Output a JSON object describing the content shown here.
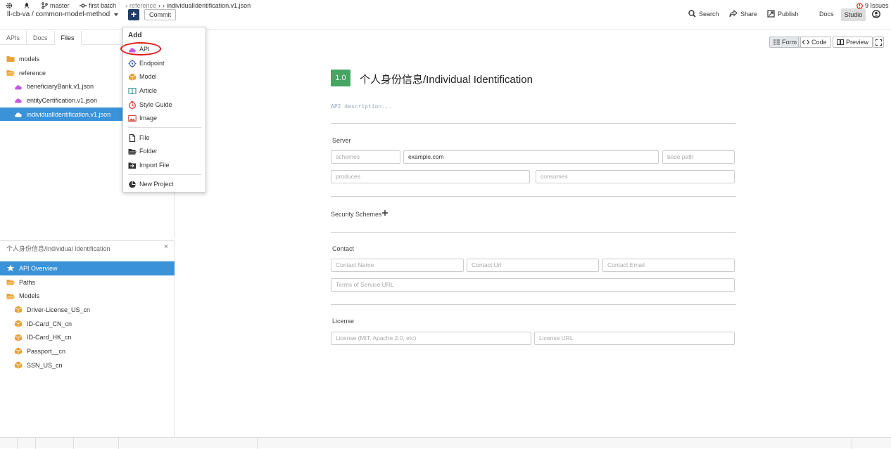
{
  "topbar": {
    "project": "ll-cb-va / common-model-method",
    "add_label": "+",
    "commit_label": "Commit",
    "search_label": "Search",
    "share_label": "Share",
    "publish_label": "Publish",
    "docs_label": "Docs",
    "studio_label": "Studio"
  },
  "sidebar": {
    "tabs": [
      "APIs",
      "Docs",
      "Files"
    ],
    "active_tab": "Files",
    "files": [
      {
        "label": "models",
        "type": "folder"
      },
      {
        "label": "reference",
        "type": "folder"
      },
      {
        "label": "beneficiaryBank.v1.json",
        "type": "api"
      },
      {
        "label": "entityCertification.v1.json",
        "type": "api"
      },
      {
        "label": "individualIdentification.v1.json",
        "type": "api",
        "selected": true
      }
    ]
  },
  "outline": {
    "title": "个人身份信息/Individual Identification",
    "close": "×",
    "items": [
      {
        "label": "API Overview",
        "type": "star",
        "selected": true
      },
      {
        "label": "Paths",
        "type": "folder"
      },
      {
        "label": "Models",
        "type": "folder"
      },
      {
        "label": "Driver-License_US_cn",
        "type": "model"
      },
      {
        "label": "ID-Card_CN_cn",
        "type": "model"
      },
      {
        "label": "ID-Card_HK_cn",
        "type": "model"
      },
      {
        "label": "Passport__cn",
        "type": "model"
      },
      {
        "label": "SSN_US_cn",
        "type": "model"
      }
    ]
  },
  "dropdown": {
    "header": "Add",
    "items": [
      "API",
      "Endpoint",
      "Model",
      "Article",
      "Style Guide",
      "Image"
    ],
    "items2": [
      "File",
      "Folder",
      "Import File"
    ],
    "items3": [
      "New Project"
    ]
  },
  "toolbar": {
    "form_label": "Form",
    "code_label": "Code",
    "preview_label": "Preview"
  },
  "editor": {
    "version": "1.0",
    "title": "个人身份信息/Individual Identification",
    "description_placeholder": "API description...",
    "server_label": "Server",
    "schemes_placeholder": "schemes",
    "host_value": "example.com",
    "basepath_placeholder": "base path",
    "produces_placeholder": "produces",
    "consumes_placeholder": "consumes",
    "security_label": "Security Schemes",
    "contact_label": "Contact",
    "contact_name_placeholder": "Contact Name",
    "contact_url_placeholder": "Contact Url",
    "contact_email_placeholder": "Contact Email",
    "tos_placeholder": "Terms of Service URL",
    "license_label": "License",
    "license_placeholder": "License (MIT, Apache 2.0, etc)",
    "license_url_placeholder": "License URL"
  },
  "statusbar": {
    "branch": "master",
    "commit": "first batch",
    "crumb1": "reference",
    "crumb2": "individualIdentification.v1.json",
    "issues": "9 Issues"
  },
  "colors": {
    "accent": "#3a92d8",
    "navy": "#1f3d67",
    "version_green": "#45a563",
    "api_icon": "#c25ce0",
    "model_icon": "#e8a23a",
    "folder_icon": "#e8a23a",
    "error_red": "#e02020"
  }
}
